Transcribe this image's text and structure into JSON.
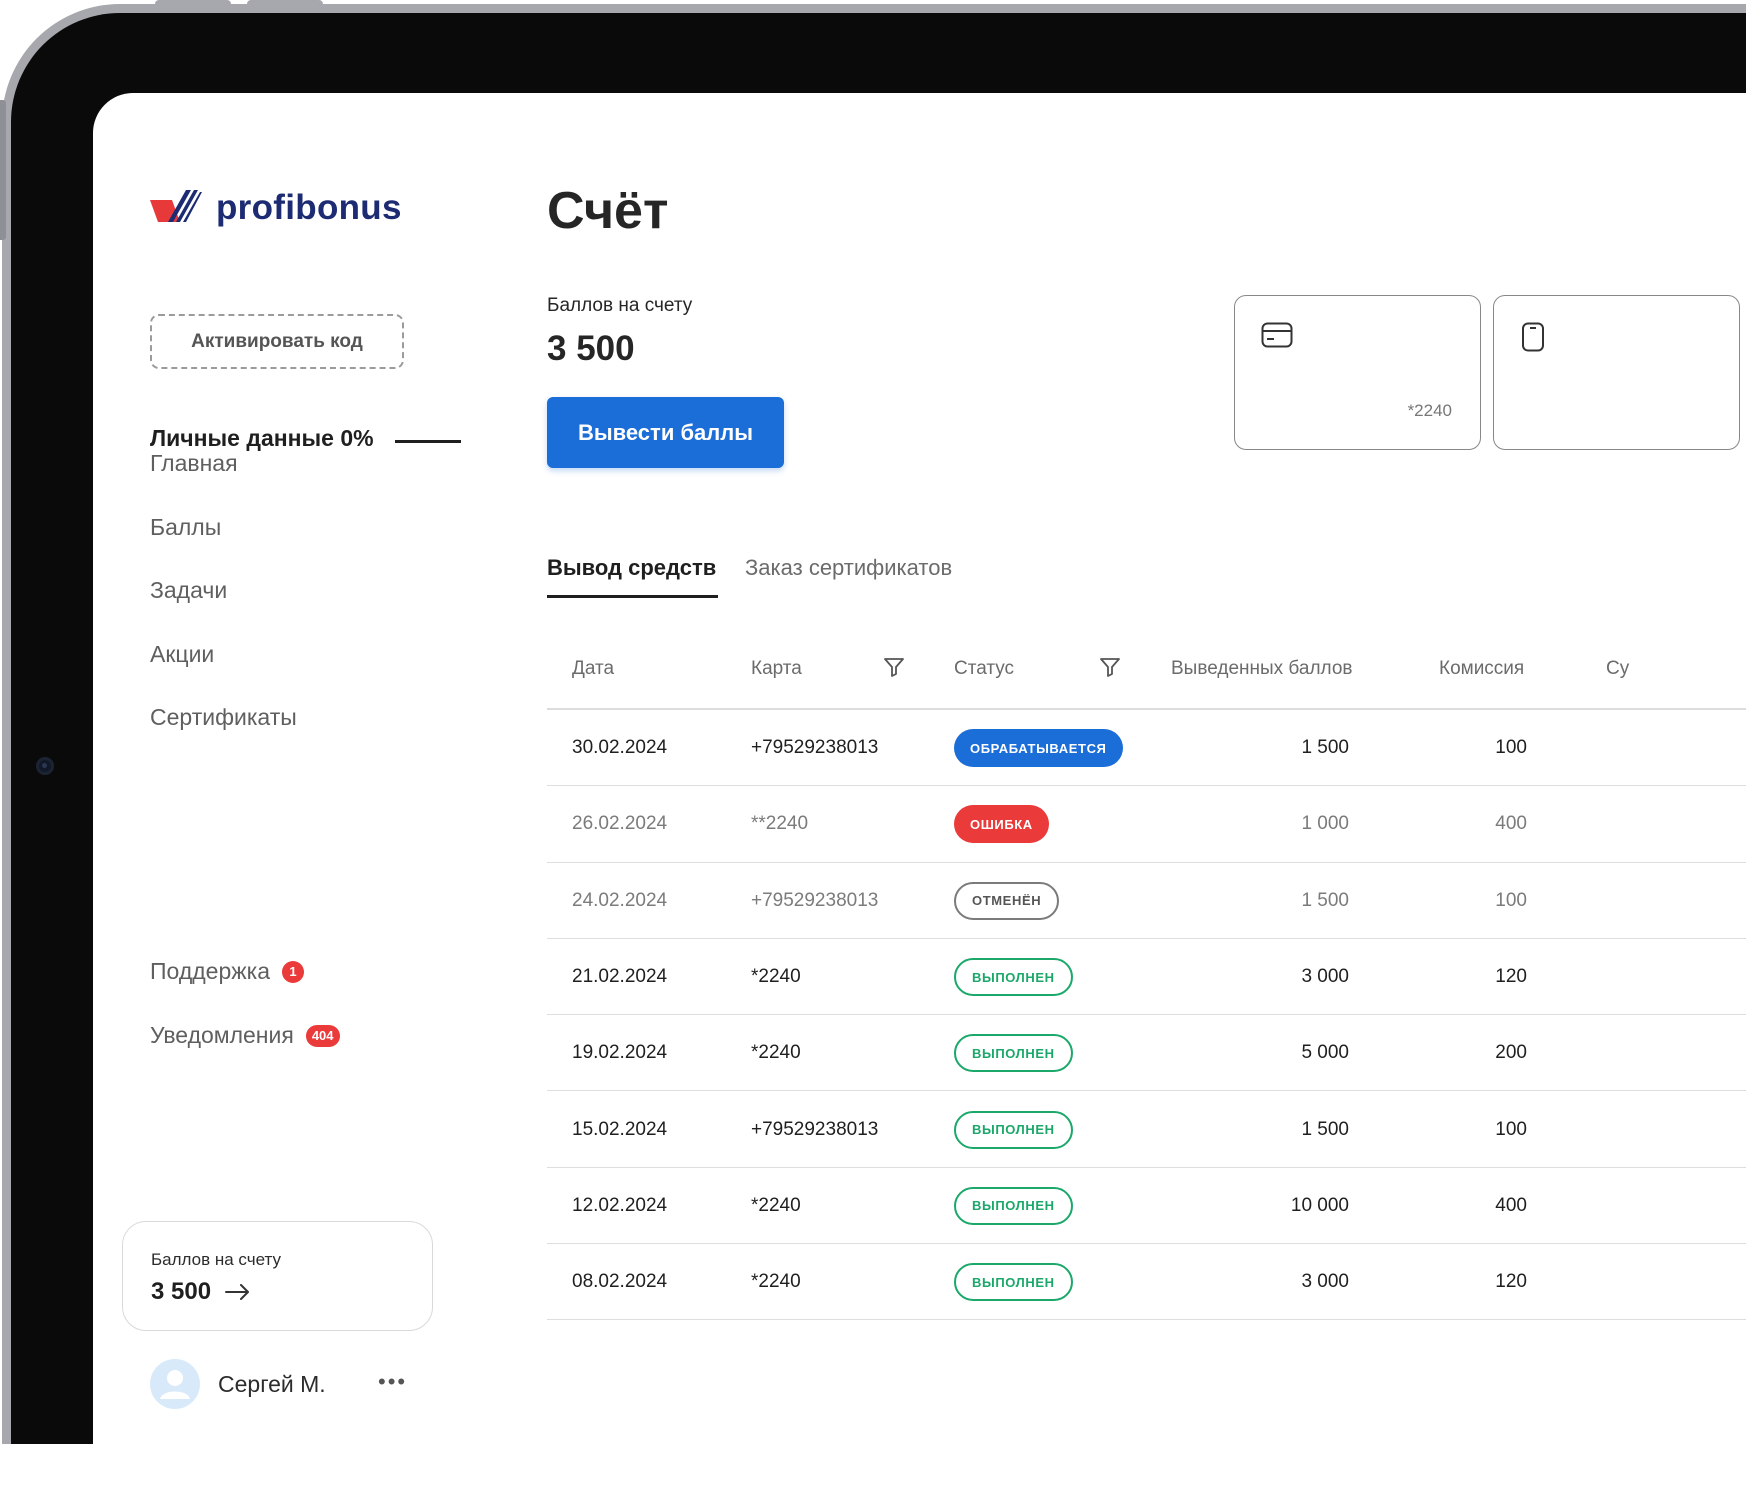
{
  "brand": {
    "name": "profibonus"
  },
  "sidebar": {
    "activate_label": "Активировать код",
    "active_item": "Личные данные 0%",
    "items": [
      {
        "label": "Главная"
      },
      {
        "label": "Баллы"
      },
      {
        "label": "Задачи"
      },
      {
        "label": "Акции"
      },
      {
        "label": "Сертификаты"
      }
    ],
    "support": {
      "label": "Поддержка",
      "badge": "1"
    },
    "notifications": {
      "label": "Уведомления",
      "badge": "404"
    },
    "balance_card": {
      "label": "Баллов на счету",
      "value": "3 500"
    },
    "user": {
      "name": "Сергей М.",
      "menu": "•••"
    }
  },
  "main": {
    "title": "Счёт",
    "balance_label": "Баллов на счету",
    "balance_value": "3 500",
    "withdraw_label": "Вывести баллы",
    "cards": [
      {
        "icon": "credit-card-icon",
        "number": "*2240"
      },
      {
        "icon": "phone-icon",
        "number": ""
      }
    ],
    "tabs": [
      {
        "label": "Вывод средств",
        "active": true
      },
      {
        "label": "Заказ сертификатов",
        "active": false
      }
    ],
    "table": {
      "columns": [
        "Дата",
        "Карта",
        "Статус",
        "Выведенных баллов",
        "Комиссия",
        "Су"
      ],
      "rows": [
        {
          "date": "30.02.2024",
          "card": "+79529238013",
          "status": "ОБРАБАТЫВАЕТСЯ",
          "status_type": "processing",
          "withdrawn": "1 500",
          "fee": "100"
        },
        {
          "date": "26.02.2024",
          "card": "**2240",
          "status": "ОШИБКА",
          "status_type": "error",
          "withdrawn": "1 000",
          "fee": "400"
        },
        {
          "date": "24.02.2024",
          "card": "+79529238013",
          "status": "ОТМЕНЁН",
          "status_type": "canceled",
          "withdrawn": "1 500",
          "fee": "100"
        },
        {
          "date": "21.02.2024",
          "card": "*2240",
          "status": "ВЫПОЛНЕН",
          "status_type": "done",
          "withdrawn": "3 000",
          "fee": "120"
        },
        {
          "date": "19.02.2024",
          "card": "*2240",
          "status": "ВЫПОЛНЕН",
          "status_type": "done",
          "withdrawn": "5 000",
          "fee": "200"
        },
        {
          "date": "15.02.2024",
          "card": "+79529238013",
          "status": "ВЫПОЛНЕН",
          "status_type": "done",
          "withdrawn": "1 500",
          "fee": "100"
        },
        {
          "date": "12.02.2024",
          "card": "*2240",
          "status": "ВЫПОЛНЕН",
          "status_type": "done",
          "withdrawn": "10 000",
          "fee": "400"
        },
        {
          "date": "08.02.2024",
          "card": "*2240",
          "status": "ВЫПОЛНЕН",
          "status_type": "done",
          "withdrawn": "3 000",
          "fee": "120"
        }
      ]
    }
  },
  "colors": {
    "brand_blue": "#1c2b72",
    "brand_red": "#e8393a",
    "primary": "#1b6dd8",
    "error": "#ea3a3a",
    "success": "#1ba86a"
  }
}
